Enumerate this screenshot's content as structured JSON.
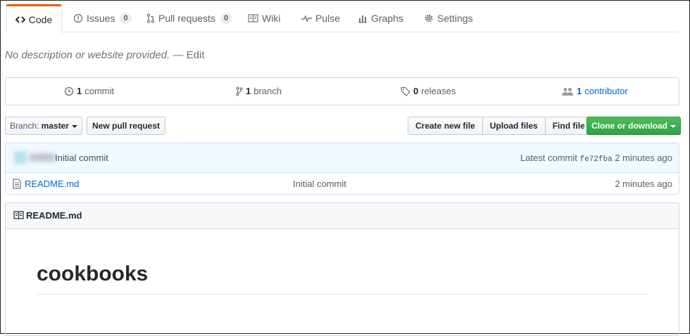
{
  "tabs": [
    {
      "label": "Code",
      "icon": "code-icon",
      "selected": true
    },
    {
      "label": "Issues",
      "icon": "issue-opened-icon",
      "count": "0"
    },
    {
      "label": "Pull requests",
      "icon": "git-pull-request-icon",
      "count": "0"
    },
    {
      "label": "Wiki",
      "icon": "book-icon"
    },
    {
      "label": "Pulse",
      "icon": "pulse-icon"
    },
    {
      "label": "Graphs",
      "icon": "graph-icon"
    },
    {
      "label": "Settings",
      "icon": "gear-icon"
    }
  ],
  "description": {
    "text": "No description or website provided.",
    "separator": "—",
    "edit": "Edit"
  },
  "summary": {
    "commits": {
      "count": "1",
      "label": "commit"
    },
    "branches": {
      "count": "1",
      "label": "branch"
    },
    "releases": {
      "count": "0",
      "label": "releases"
    },
    "contributors": {
      "count": "1",
      "label": "contributor"
    }
  },
  "toolbar": {
    "branch_prefix": "Branch:",
    "branch_name": "master",
    "new_pull_request": "New pull request",
    "create_new_file": "Create new file",
    "upload_files": "Upload files",
    "find_file": "Find file",
    "clone_or_download": "Clone or download"
  },
  "latest_commit": {
    "message": "Initial commit",
    "label": "Latest commit",
    "sha": "fe72fba",
    "age": "2 minutes ago"
  },
  "files": [
    {
      "name": "README.md",
      "message": "Initial commit",
      "age": "2 minutes ago"
    }
  ],
  "readme": {
    "filename": "README.md",
    "heading": "cookbooks"
  },
  "colors": {
    "accent_tab": "#e36209",
    "link": "#0366d6",
    "green_button": "#2fa243",
    "commit_bar": "#f1f8ff"
  }
}
